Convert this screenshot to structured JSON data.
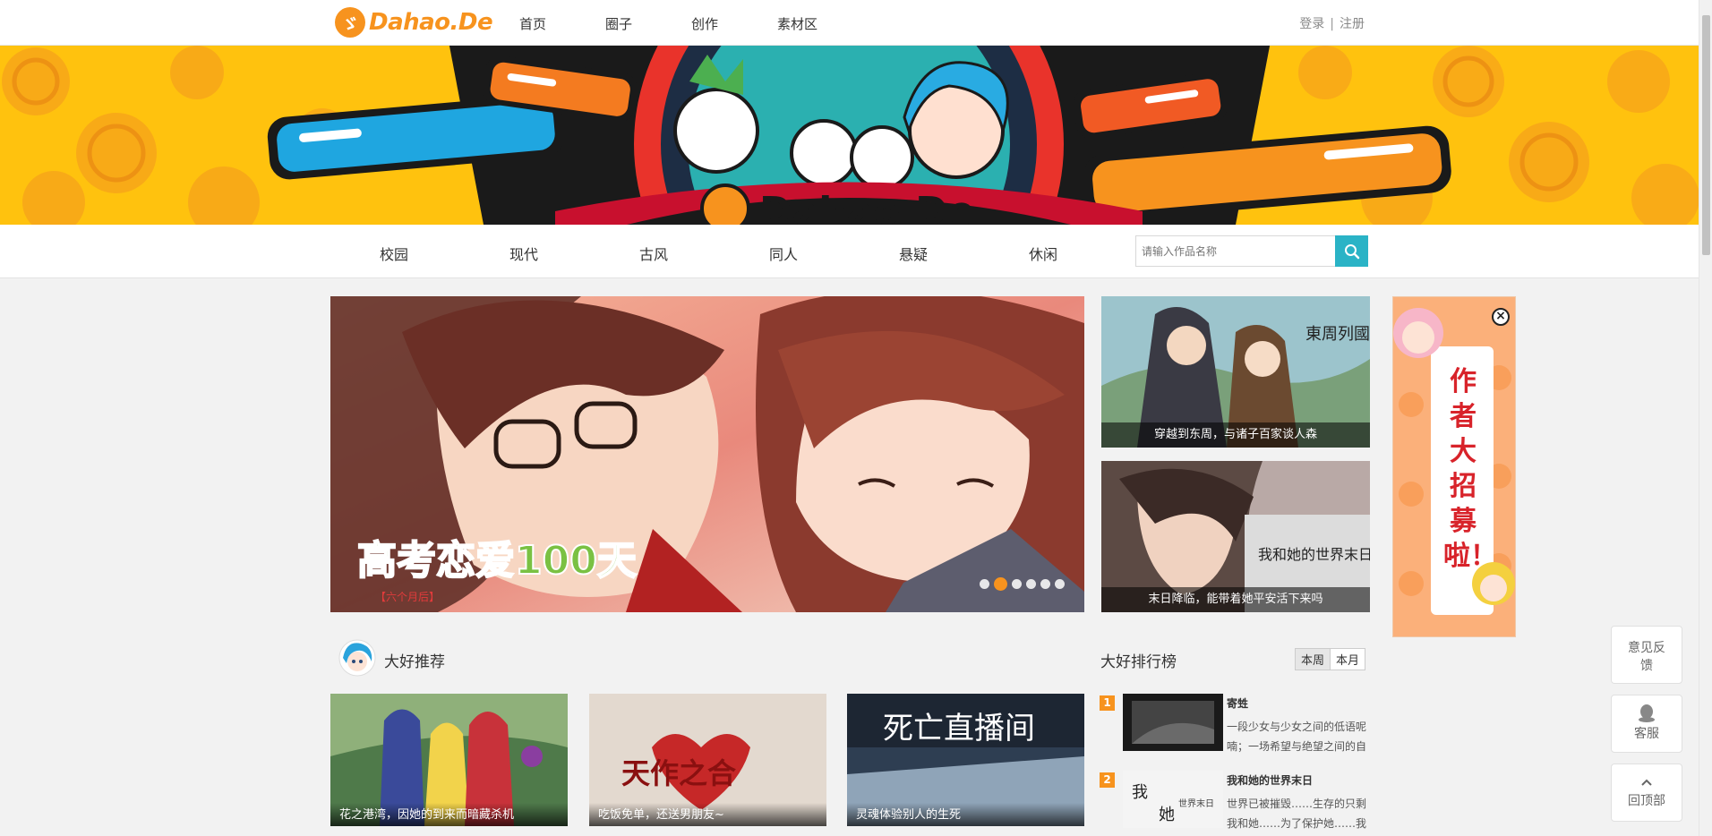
{
  "brand": {
    "name": "Dahao.De"
  },
  "nav": {
    "items": [
      "首页",
      "圈子",
      "创作",
      "素材区"
    ],
    "login": "登录",
    "sep": "|",
    "register": "注册"
  },
  "banner": {
    "logo_text": "Dahao.De"
  },
  "categories": [
    "校园",
    "现代",
    "古风",
    "同人",
    "悬疑",
    "休闲"
  ],
  "search": {
    "placeholder": "请输入作品名称"
  },
  "slider": {
    "title_main": "高考恋爱100天",
    "subtitle": "【六个月后】",
    "dots": 6,
    "active_dot": 2
  },
  "side_cards": [
    {
      "caption": "穿越到东周，与诸子百家谈人森",
      "art_text": "東周列國志"
    },
    {
      "caption": "末日降临，能带着她平安活下来吗",
      "art_text": "我和她的世界末日"
    }
  ],
  "ad": {
    "text": "作者大招募啦！",
    "close": "×"
  },
  "recommend": {
    "title": "大好推荐",
    "items": [
      {
        "caption": "花之港湾，因她的到来而暗藏杀机"
      },
      {
        "caption": "吃饭免单，还送男朋友~",
        "art_text": "天作之合"
      },
      {
        "caption": "灵魂体验别人的生死",
        "art_text": "死亡直播间"
      }
    ]
  },
  "ranking": {
    "title": "大好排行榜",
    "tabs": [
      "本周",
      "本月"
    ],
    "items": [
      {
        "rank": "1",
        "title": "寄甡",
        "desc": "一段少女与少女之间的低语呢喃；一场希望与绝望之间的自"
      },
      {
        "rank": "2",
        "title": "我和她的世界末日",
        "desc": "世界已被摧毁……生存的只剩我和她……为了保护她……我"
      }
    ]
  },
  "float": {
    "feedback": "意见反馈",
    "service": "客服",
    "top": "回顶部"
  },
  "colors": {
    "accent": "#f7931e",
    "search_btn": "#2ab3c6",
    "banner_yellow": "#ffc20e"
  }
}
